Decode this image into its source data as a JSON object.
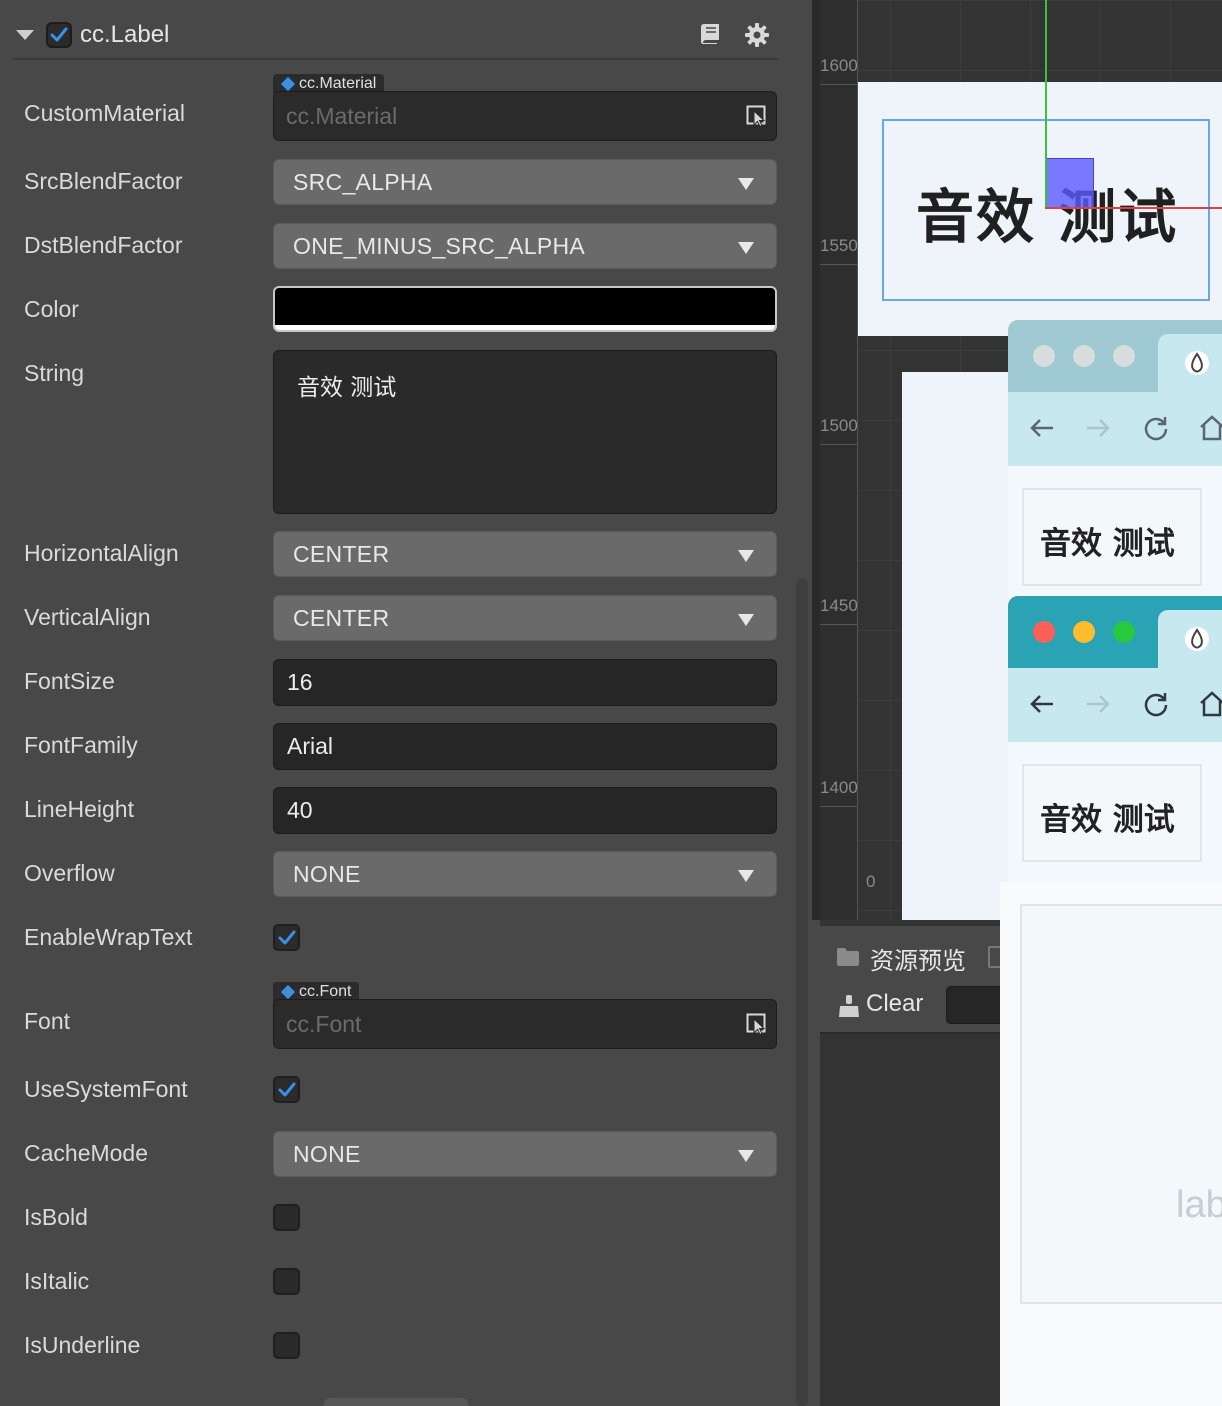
{
  "component": {
    "title": "cc.Label",
    "enabled": true
  },
  "properties": {
    "custom_material": {
      "label": "CustomMaterial",
      "tag": "cc.Material",
      "placeholder": "cc.Material"
    },
    "src_blend": {
      "label": "SrcBlendFactor",
      "value": "SRC_ALPHA"
    },
    "dst_blend": {
      "label": "DstBlendFactor",
      "value": "ONE_MINUS_SRC_ALPHA"
    },
    "color": {
      "label": "Color",
      "value": "#000000"
    },
    "string": {
      "label": "String",
      "value": "音效 测试"
    },
    "h_align": {
      "label": "HorizontalAlign",
      "value": "CENTER"
    },
    "v_align": {
      "label": "VerticalAlign",
      "value": "CENTER"
    },
    "font_size": {
      "label": "FontSize",
      "value": "16"
    },
    "font_family": {
      "label": "FontFamily",
      "value": "Arial"
    },
    "line_height": {
      "label": "LineHeight",
      "value": "40"
    },
    "overflow": {
      "label": "Overflow",
      "value": "NONE"
    },
    "wrap_text": {
      "label": "EnableWrapText",
      "checked": true
    },
    "font": {
      "label": "Font",
      "tag": "cc.Font",
      "placeholder": "cc.Font"
    },
    "system_font": {
      "label": "UseSystemFont",
      "checked": true
    },
    "cache_mode": {
      "label": "CacheMode",
      "value": "NONE"
    },
    "is_bold": {
      "label": "IsBold",
      "checked": false
    },
    "is_italic": {
      "label": "IsItalic",
      "checked": false
    },
    "is_underline": {
      "label": "IsUnderline",
      "checked": false
    }
  },
  "scene": {
    "ruler": [
      "1600",
      "1550",
      "1500",
      "1450",
      "1400",
      "0"
    ],
    "label_text": "音效 测试",
    "preview_text_1": "音效 测试",
    "preview_text_2": "音效 测试"
  },
  "assets_panel": {
    "tab_label": "资源预览",
    "clear_label": "Clear"
  },
  "preview": {
    "fragment": "lab"
  },
  "colors": {
    "accent": "#3b8fe6",
    "traffic_red": "#ff5f57",
    "traffic_yellow": "#febc2e",
    "traffic_green": "#28c840"
  }
}
